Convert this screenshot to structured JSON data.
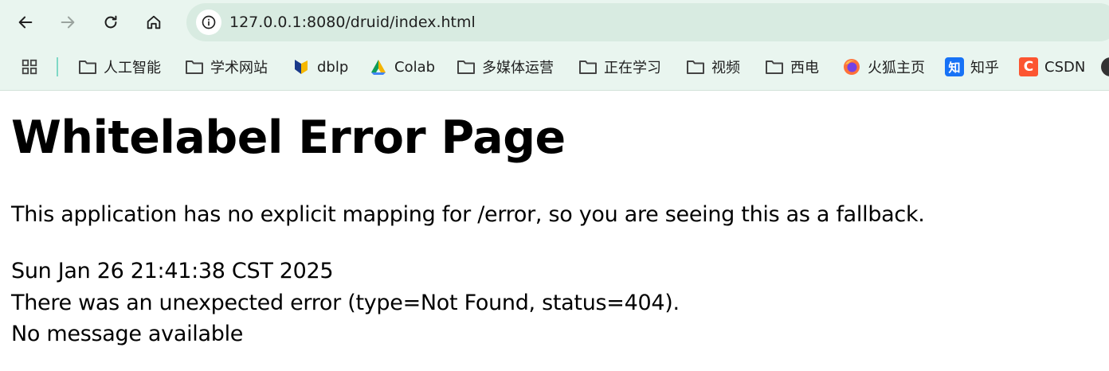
{
  "browser": {
    "url": "127.0.0.1:8080/druid/index.html",
    "nav": {
      "back": "back-arrow-icon",
      "forward": "forward-arrow-icon",
      "reload": "reload-icon",
      "home": "home-icon"
    },
    "bookmarks": [
      {
        "label": "人工智能",
        "icon": "folder-icon"
      },
      {
        "label": "学术网站",
        "icon": "folder-icon"
      },
      {
        "label": "dblp",
        "icon": "dblp-icon"
      },
      {
        "label": "Colab",
        "icon": "colab-icon"
      },
      {
        "label": "多媒体运营",
        "icon": "folder-icon"
      },
      {
        "label": "正在学习",
        "icon": "folder-icon"
      },
      {
        "label": "视频",
        "icon": "folder-icon"
      },
      {
        "label": "西电",
        "icon": "folder-icon"
      },
      {
        "label": "火狐主页",
        "icon": "firefox-icon"
      },
      {
        "label": "知乎",
        "icon": "zhihu-icon",
        "badge": "知"
      },
      {
        "label": "CSDN",
        "icon": "csdn-icon",
        "badge": "C"
      }
    ]
  },
  "page": {
    "title": "Whitelabel Error Page",
    "message": "This application has no explicit mapping for /error, so you are seeing this as a fallback.",
    "timestamp": "Sun Jan 26 21:41:38 CST 2025",
    "error": "There was an unexpected error (type=Not Found, status=404).",
    "detail": "No message available"
  },
  "colors": {
    "chrome_bg": "#e9f5ef",
    "omnibox_bg": "#d8ebe1",
    "csdn_red": "#fc5531",
    "zhihu_blue": "#1772f6"
  }
}
